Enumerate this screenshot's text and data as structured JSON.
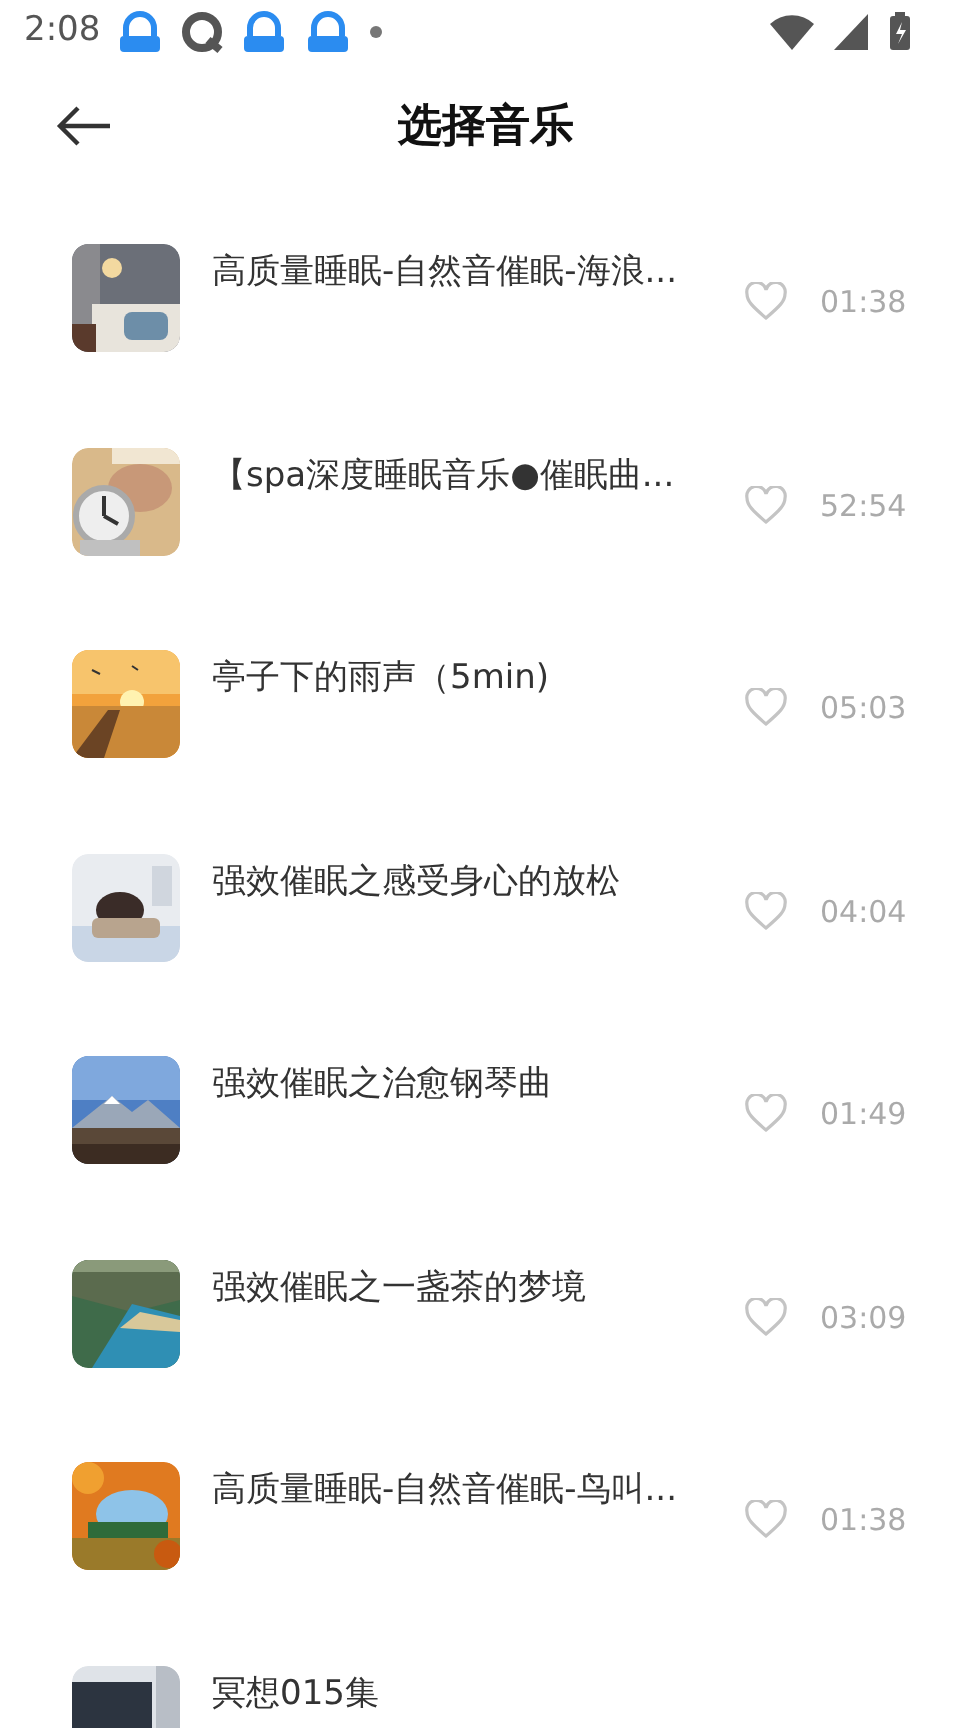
{
  "status_bar": {
    "time": "2:08"
  },
  "header": {
    "title": "选择音乐"
  },
  "songs": [
    {
      "title": "高质量睡眠-自然音催眠-海浪...",
      "liked": false,
      "duration": "01:38"
    },
    {
      "title": "【spa深度睡眠音乐●催眠曲...",
      "liked": false,
      "duration": "52:54"
    },
    {
      "title": "亭子下的雨声（5min)",
      "liked": false,
      "duration": "05:03"
    },
    {
      "title": "强效催眠之感受身心的放松",
      "liked": false,
      "duration": "04:04"
    },
    {
      "title": "强效催眠之治愈钢琴曲",
      "liked": false,
      "duration": "01:49"
    },
    {
      "title": "强效催眠之一盏茶的梦境",
      "liked": false,
      "duration": "03:09"
    },
    {
      "title": "高质量睡眠-自然音催眠-鸟叫...",
      "liked": false,
      "duration": "01:38"
    },
    {
      "title": "冥想015集"
    }
  ]
}
